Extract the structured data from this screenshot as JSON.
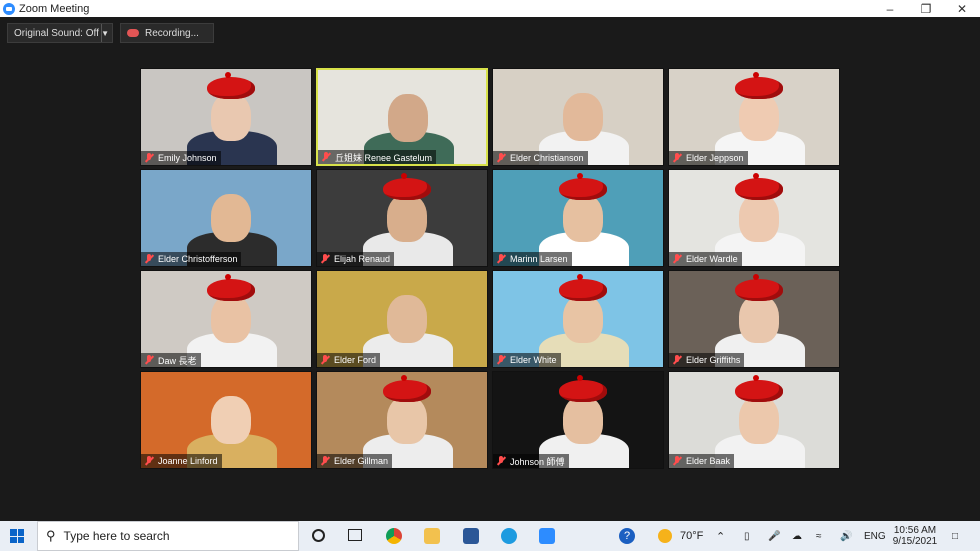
{
  "window": {
    "title": "Zoom Meeting"
  },
  "toolbar": {
    "original_sound": "Original Sound: Off",
    "recording": "Recording..."
  },
  "participants": [
    {
      "name": "Emily Johnson",
      "bg": "#c9c6c2",
      "skin": "#e9c8b0",
      "shirt": "#2a3550",
      "beret": true
    },
    {
      "name": "丘姐妹 Renee Gastelum",
      "bg": "#e6e4dd",
      "skin": "#d2a889",
      "shirt": "#3f6b58",
      "beret": false,
      "active": true
    },
    {
      "name": "Elder Christianson",
      "bg": "#d7d0c5",
      "skin": "#e2b99a",
      "shirt": "#f2f2f2",
      "beret": false
    },
    {
      "name": "Elder Jeppson",
      "bg": "#d8d2c8",
      "skin": "#efcbb2",
      "shirt": "#f5f5f5",
      "beret": true
    },
    {
      "name": "Elder Christofferson",
      "bg": "#7aa7c9",
      "skin": "#e2b894",
      "shirt": "#2c2c2c",
      "beret": false
    },
    {
      "name": "Elijah Renaud",
      "bg": "#3c3c3c",
      "skin": "#d8ae8c",
      "shirt": "#e9e9e9",
      "beret": true
    },
    {
      "name": "Marinn Larsen",
      "bg": "#4f9fb8",
      "skin": "#e6c0a0",
      "shirt": "#ffffff",
      "beret": true
    },
    {
      "name": "Elder Wardle",
      "bg": "#e4e4e0",
      "skin": "#edc9b0",
      "shirt": "#f4f4f4",
      "beret": true
    },
    {
      "name": "Daw 長老",
      "bg": "#cfcac4",
      "skin": "#e9c2a4",
      "shirt": "#f2f2f2",
      "beret": true
    },
    {
      "name": "Elder Ford",
      "bg": "#c9a94a",
      "skin": "#e0b998",
      "shirt": "#ececec",
      "beret": false
    },
    {
      "name": "Elder White",
      "bg": "#7ec4e6",
      "skin": "#e8c4a4",
      "shirt": "#e6ddb8",
      "beret": true
    },
    {
      "name": "Elder Griffiths",
      "bg": "#6b6158",
      "skin": "#e9c7ad",
      "shirt": "#f0f0f0",
      "beret": true
    },
    {
      "name": "Joanne Linford",
      "bg": "#d46a2a",
      "skin": "#f0cfb4",
      "shirt": "#d9b060",
      "beret": false
    },
    {
      "name": "Elder Gillman",
      "bg": "#b48a5c",
      "skin": "#e8c6a8",
      "shirt": "#ededed",
      "beret": true
    },
    {
      "name": "Johnson 師傅",
      "bg": "#141414",
      "skin": "#e5bfa0",
      "shirt": "#f0f0f0",
      "beret": true
    },
    {
      "name": "Elder Baak",
      "bg": "#dcdcd8",
      "skin": "#ecc8ac",
      "shirt": "#f2f2f2",
      "beret": true
    }
  ],
  "taskbar": {
    "search_placeholder": "Type here to search",
    "weather": "70°F",
    "lang": "ENG",
    "time": "10:56 AM",
    "date": "9/15/2021"
  }
}
